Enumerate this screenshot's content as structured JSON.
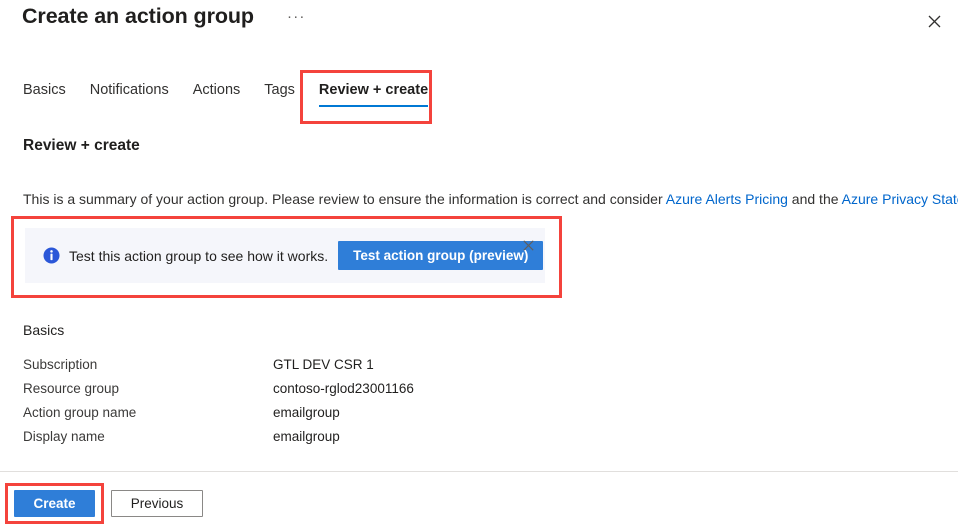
{
  "header": {
    "title": "Create an action group",
    "ellipsis": "···",
    "close_icon": "close-icon"
  },
  "tabs": [
    {
      "label": "Basics",
      "active": false
    },
    {
      "label": "Notifications",
      "active": false
    },
    {
      "label": "Actions",
      "active": false
    },
    {
      "label": "Tags",
      "active": false
    },
    {
      "label": "Review + create",
      "active": true
    }
  ],
  "content": {
    "section_heading": "Review + create",
    "summary": {
      "text_before_link1": "This is a summary of your action group. Please review to ensure the information is correct and consider ",
      "link1": "Azure Alerts Pricing",
      "text_between": " and the ",
      "link2": "Azure Privacy Statement",
      "text_after": "."
    },
    "info_banner": {
      "icon": "info-icon",
      "message": "Test this action group to see how it works.",
      "button_label": "Test action group (preview)",
      "close_icon": "close-icon"
    },
    "basics": {
      "title": "Basics",
      "rows": [
        {
          "label": "Subscription",
          "value": "GTL DEV CSR 1"
        },
        {
          "label": "Resource group",
          "value": "contoso-rglod23001166"
        },
        {
          "label": "Action group name",
          "value": "emailgroup"
        },
        {
          "label": "Display name",
          "value": "emailgroup"
        }
      ]
    }
  },
  "footer": {
    "create_label": "Create",
    "previous_label": "Previous"
  },
  "colors": {
    "accent_blue": "#0078d4",
    "button_blue": "#2f7ed8",
    "link_blue": "#0066cc",
    "annotation_red": "#f4433c",
    "banner_bg": "#f5f6fb"
  }
}
